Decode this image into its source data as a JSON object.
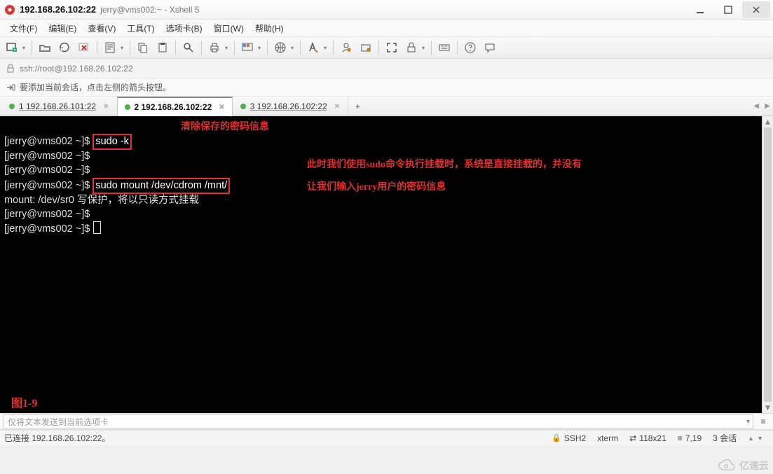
{
  "window": {
    "title_main": "192.168.26.102:22",
    "title_sub": "jerry@vms002:~ - Xshell 5"
  },
  "menu": {
    "items": [
      "文件(F)",
      "编辑(E)",
      "查看(V)",
      "工具(T)",
      "选项卡(B)",
      "窗口(W)",
      "帮助(H)"
    ]
  },
  "address": {
    "url": "ssh://root@192.168.26.102:22"
  },
  "infobar": {
    "text": "要添加当前会话，点击左侧的箭头按钮。"
  },
  "tabs": {
    "items": [
      {
        "label": "1 192.168.26.101:22",
        "active": false
      },
      {
        "label": "2 192.168.26.102:22",
        "active": true
      },
      {
        "label": "3 192.168.26.102:22",
        "active": false
      }
    ],
    "add_label": "+"
  },
  "terminal": {
    "lines": [
      {
        "prompt": "[jerry@vms002 ~]$ ",
        "cmd_boxed": "sudo -k"
      },
      {
        "prompt": "[jerry@vms002 ~]$",
        "cmd": ""
      },
      {
        "prompt": "[jerry@vms002 ~]$",
        "cmd": ""
      },
      {
        "prompt": "[jerry@vms002 ~]$ ",
        "cmd_boxed": "sudo mount /dev/cdrom /mnt/"
      },
      {
        "prompt": "mount: /dev/sr0 写保护，将以只读方式挂载",
        "cmd": ""
      },
      {
        "prompt": "[jerry@vms002 ~]$",
        "cmd": ""
      },
      {
        "prompt": "[jerry@vms002 ~]$ ",
        "cursor": true
      }
    ],
    "annotations": {
      "note1": "清除保存的密码信息",
      "note2_line1": "此时我们使用sudo命令执行挂载时，系统是直接挂载的，并没有",
      "note2_line2": "让我们输入jerry用户的密码信息",
      "figure_label": "图1-9"
    }
  },
  "sendbar": {
    "placeholder": "仅将文本发送到当前选项卡"
  },
  "status": {
    "conn": "已连接  192.168.26.102:22。",
    "ssh": "SSH2",
    "term": "xterm",
    "size": "118x21",
    "pos": "7,19",
    "sessions": "3 会话"
  },
  "watermark": {
    "text": "亿速云"
  },
  "icons": {
    "size_icon": "⇄",
    "pos_icon": "≡",
    "lock_icon": "🔒",
    "arrow_icon": "↪"
  }
}
